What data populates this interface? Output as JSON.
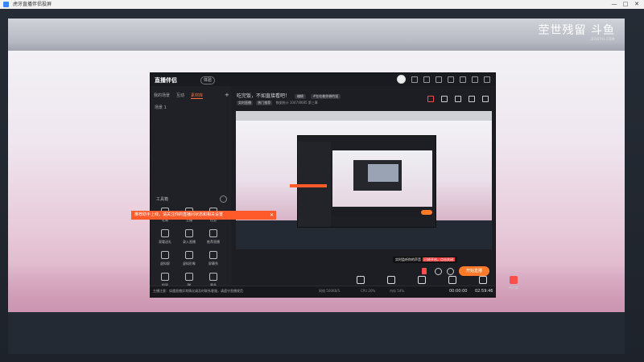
{
  "window": {
    "title": "虎牙直播伴侣投屏",
    "controls": {
      "minimize": "—",
      "maximize": "□",
      "close": "✕"
    }
  },
  "brand": {
    "text": "茔世残留 斗鱼",
    "sub": "DOUYU.COM"
  },
  "app": {
    "logo": "直播伴侣",
    "logo_badge": "体验",
    "left_tabs": [
      "我的场景",
      "互动",
      "素材库"
    ],
    "scene_row": "场景 1",
    "tools_title": "工具箱",
    "tools": [
      {
        "label": "礼物"
      },
      {
        "label": "主播"
      },
      {
        "label": "任务"
      },
      {
        "label": "观看送礼"
      },
      {
        "label": "录入直播"
      },
      {
        "label": "推荐直播"
      },
      {
        "label": "虚拟屏"
      },
      {
        "label": "虚拟形象"
      },
      {
        "label": "屏幕秀"
      },
      {
        "label": "投屏"
      },
      {
        "label": "PK"
      },
      {
        "label": "更多"
      }
    ],
    "room": {
      "title": "吃完饭，不如直接看吧！",
      "tag_edit": "编辑",
      "category": "#在吃着你做的饭",
      "row2_tags": [
        "实时直播",
        "热门推荐"
      ],
      "row2_text": "数据统计  1047/8685  第三章"
    },
    "toolbar": [
      {
        "label": "直播屏幕"
      },
      {
        "label": "摄像头"
      },
      {
        "label": "手机投屏"
      },
      {
        "label": "多媒体"
      },
      {
        "label": "麦克风"
      },
      {
        "label": "扬声器"
      }
    ],
    "tooltip": {
      "text": "实时监听你的声音",
      "highlight": "已经开启，点击关闭"
    },
    "start_button": "开始直播",
    "notice": "主播注意：如遇直播异常情况请及时联系客服，请遵守直播规范",
    "stats": [
      "网络 500KB/S",
      "CPU 20%",
      "内存 54%"
    ],
    "timer_left": "00:00:00",
    "timer_right": "02:59:46"
  },
  "toast": {
    "text": "推荐助手上线，请关注你的直播间状态和相关设置",
    "close": "✕"
  }
}
